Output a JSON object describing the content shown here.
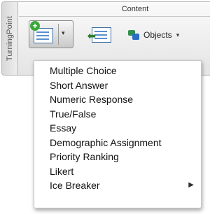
{
  "side_tab": {
    "label": "TurningPoint"
  },
  "group": {
    "title": "Content"
  },
  "objects_button": {
    "label": "Objects"
  },
  "menu": {
    "items": [
      {
        "label": "Multiple Choice"
      },
      {
        "label": "Short Answer"
      },
      {
        "label": "Numeric Response"
      },
      {
        "label": "True/False"
      },
      {
        "label": "Essay"
      },
      {
        "label": "Demographic Assignment"
      },
      {
        "label": "Priority Ranking"
      },
      {
        "label": "Likert"
      },
      {
        "label": "Ice Breaker",
        "has_submenu": true
      }
    ]
  },
  "icons": {
    "new_slide": "new-slide-icon",
    "plus": "plus-icon",
    "objects": "objects-icon",
    "dropdown": "chevron-down-icon",
    "submenu": "chevron-right-icon"
  },
  "colors": {
    "plus_green": "#3aa83a",
    "slide_blue": "#3a6ea5"
  }
}
